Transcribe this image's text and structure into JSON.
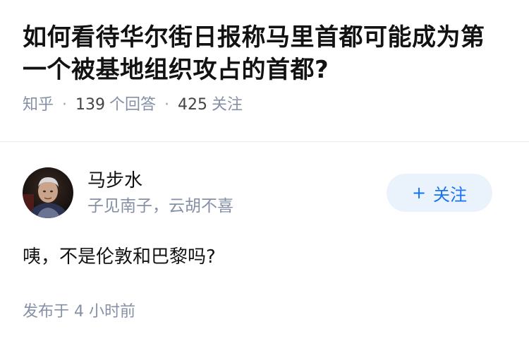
{
  "question": {
    "title": "如何看待华尔街日报称马里首都可能成为第一个被基地组织攻占的首都?",
    "source": "知乎",
    "answer_count": "139",
    "answer_label": "个回答",
    "follower_count": "425",
    "follower_label": "关注"
  },
  "answer": {
    "author_name": "马步水",
    "author_bio": "子见南子，云胡不喜",
    "follow_button": {
      "icon": "+",
      "label": "关注"
    },
    "content": "咦，不是伦敦和巴黎吗?",
    "publish_time": "发布于 4 小时前"
  },
  "colors": {
    "accent": "#1772f6",
    "accent_bg": "#eaf2fb",
    "meta_gray": "#8590a6",
    "text": "#121212"
  }
}
